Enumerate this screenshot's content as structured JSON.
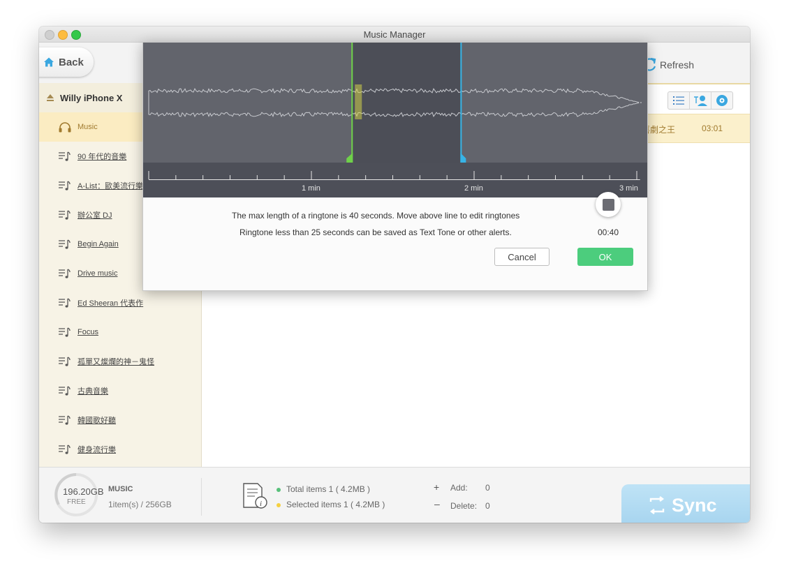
{
  "window": {
    "title": "Music Manager"
  },
  "toolbar": {
    "back_label": "Back",
    "refresh_label": "Refresh"
  },
  "device": {
    "name": "Willy  iPhone X"
  },
  "sidebar": {
    "items": [
      {
        "label": "Music",
        "icon": "headphones-icon",
        "active": true
      },
      {
        "label": "90 年代的音樂",
        "icon": "playlist-icon"
      },
      {
        "label": "A-List：歐美流行樂",
        "icon": "playlist-icon"
      },
      {
        "label": "辦公室 DJ",
        "icon": "playlist-icon"
      },
      {
        "label": "Begin Again",
        "icon": "playlist-icon"
      },
      {
        "label": "Drive music",
        "icon": "playlist-icon"
      },
      {
        "label": "Ed Sheeran 代表作",
        "icon": "playlist-icon"
      },
      {
        "label": "Focus",
        "icon": "playlist-icon"
      },
      {
        "label": "孤單又燦爛的神－鬼怪",
        "icon": "playlist-icon"
      },
      {
        "label": "古典音樂",
        "icon": "playlist-icon"
      },
      {
        "label": "韓國歌好聽",
        "icon": "playlist-icon"
      },
      {
        "label": "健身流行樂",
        "icon": "playlist-icon"
      }
    ]
  },
  "main": {
    "song_row": {
      "title": "喜劇之王",
      "duration": "03:01"
    },
    "view_buttons": [
      "list-view-icon",
      "contacts-view-icon",
      "disc-view-icon"
    ]
  },
  "dialog": {
    "ruler_labels": [
      "1 min",
      "2 min",
      "3 min"
    ],
    "message_line1": "The max length of a ringtone is 40 seconds. Move above line to edit ringtones",
    "message_line2": "Ringtone less than 25 seconds can be saved as Text Tone or other alerts.",
    "time_readout": "00:40",
    "cancel_label": "Cancel",
    "ok_label": "OK",
    "selection_start_min": 1.25,
    "selection_end_min": 1.92,
    "playhead_min": 1.28,
    "track_length_min": 3.02,
    "colors": {
      "start_marker": "#6fd14a",
      "end_marker": "#37b4e6",
      "waveform": "#c9cbd0"
    }
  },
  "bottombar": {
    "storage_gb": "196.20GB",
    "storage_free": "FREE",
    "category": "MUSIC",
    "count": "1item(s) / 256GB",
    "total_items": "Total items 1 ( 4.2MB )",
    "selected_items": "Selected items 1 ( 4.2MB )",
    "add_label": "Add:",
    "add_value": "0",
    "delete_label": "Delete:",
    "delete_value": "0",
    "sync_label": "Sync",
    "colors": {
      "total_dot": "#58c07a",
      "selected_dot": "#f5d040"
    }
  }
}
